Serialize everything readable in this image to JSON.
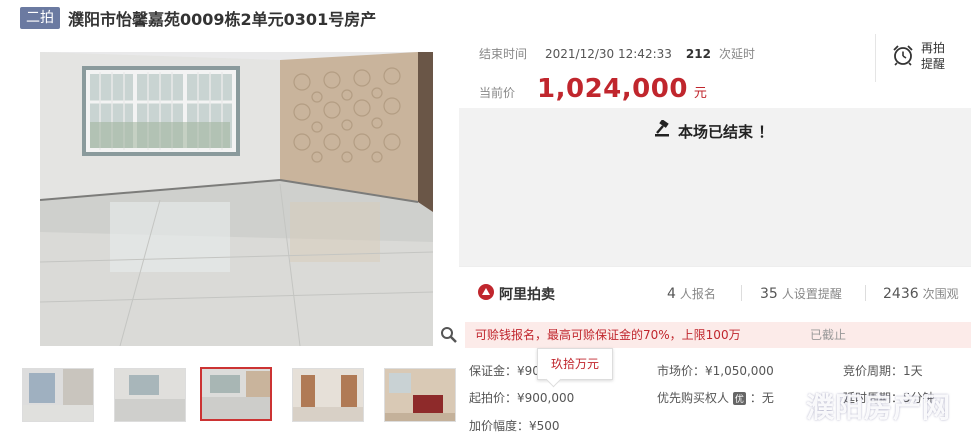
{
  "header": {
    "badge": "二拍",
    "title": "濮阳市怡馨嘉苑0009栋2单元0301号房产"
  },
  "auction": {
    "end_label": "结束时间",
    "end_time": "2021/12/30 12:42:33",
    "delay_count": "212",
    "delay_label": "次延时",
    "price_label": "当前价",
    "price": "1,024,000",
    "price_unit": "元",
    "remind_label": "再拍提醒",
    "ended_text": "本场已结束 ！"
  },
  "stats": {
    "logo_text": "阿里拍卖",
    "signups": "4",
    "signups_label": "人报名",
    "reminders": "35",
    "reminders_label": "人设置提醒",
    "views": "2436",
    "views_label": "次围观"
  },
  "notice": {
    "text": "可赊钱报名，最高可赊保证金的70%，上限100万",
    "stopped": "已截止"
  },
  "details": {
    "deposit": "保证金：¥90",
    "tooltip": "玖拾万元",
    "start_price": "起拍价：¥900,000",
    "increment": "加价幅度：¥500",
    "market_price": "市场价：¥1,050,000",
    "priority_buyer_tag": "优",
    "priority_buyer": "优先购买权人",
    "priority_buyer_value": "：无",
    "cycle": "竞价周期：1天",
    "extra": "延时周期：5分钟"
  },
  "watermark": "濮阳房产网",
  "colors": {
    "accent_red": "#c0262d",
    "badge_blue": "#6b7aa1",
    "ended_bg": "#f2f2f2",
    "notice_bg": "#fcebe9"
  },
  "icons": {
    "zoom": "search-icon",
    "remind": "alarm-clock-icon",
    "ended": "gavel-icon",
    "logo": "ali-auction-logo-icon"
  }
}
